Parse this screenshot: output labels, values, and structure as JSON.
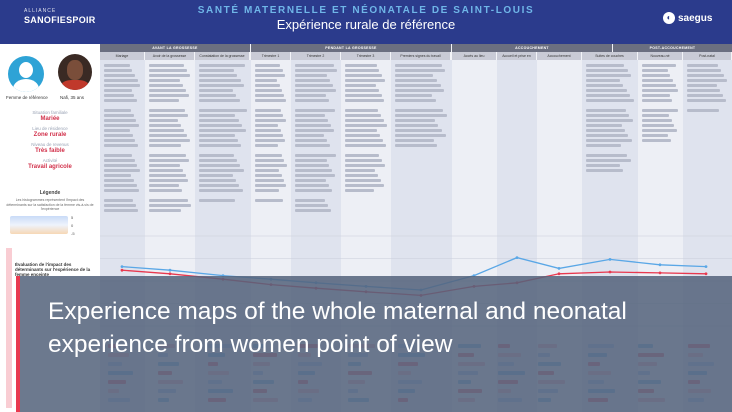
{
  "header": {
    "brand_left_small": "ALLIANCE",
    "brand_left": "SANOFIESPOIR",
    "title": "SANTÉ MATERNELLE ET NÉONATALE DE SAINT-LOUIS",
    "subtitle": "Expérience rurale de référence",
    "brand_right": "saegus"
  },
  "persona": {
    "avatar_caption": "Femme de référence",
    "person_caption": "Nafi, 35 ans",
    "fields": [
      {
        "label": "Situation familiale",
        "value": "Mariée"
      },
      {
        "label": "Lieu de résidence",
        "value": "Zone rurale"
      },
      {
        "label": "Niveau de revenus",
        "value": "Très faible"
      },
      {
        "label": "Activité",
        "value": "Travail agricole"
      }
    ],
    "legend_title": "Légende",
    "legend_text": "Les histogrammes représentent l'impact des déterminants sur la satisfaction de la femme vis-à-vis de l'expérience",
    "legend_top": "5",
    "legend_mid": "0",
    "legend_bot": "-5",
    "eval_title": "Évaluation de l'impact des déterminants sur l'expérience de la femme enceinte"
  },
  "stages": [
    {
      "label": "AVANT LA GROSSESSE"
    },
    {
      "label": "PENDANT LA GROSSESSE"
    },
    {
      "label": "ACCOUCHEMENT"
    },
    {
      "label": "POST-ACCOUCHEMENT"
    }
  ],
  "steps": [
    {
      "label": "Mariage"
    },
    {
      "label": "Avoir de la grossesse"
    },
    {
      "label": "Constatation de la grossesse"
    },
    {
      "label": "Trimestre 1"
    },
    {
      "label": "Trimestre 2"
    },
    {
      "label": "Trimestre 3"
    },
    {
      "label": "Premiers signes du travail"
    },
    {
      "label": "Accès au lieu d'accouchement"
    },
    {
      "label": "Accueil et prise en charge"
    },
    {
      "label": "Accouchement"
    },
    {
      "label": "Suites de couches"
    },
    {
      "label": "Nouveau-né"
    },
    {
      "label": "Post-natal"
    }
  ],
  "chart_data": {
    "type": "line",
    "categories": [
      "Mariage",
      "Avoir de la grossesse",
      "Constatation de la grossesse",
      "Trimestre 1",
      "Trimestre 2",
      "Trimestre 3",
      "Premiers signes du travail",
      "Accès au lieu d'accouchement",
      "Accueil et prise en charge",
      "Accouchement",
      "Suites de couches",
      "Nouveau-né",
      "Post-natal"
    ],
    "series": [
      {
        "values": [
          1.2,
          0.8,
          0.2,
          -0.4,
          -0.8,
          -1.2,
          -1.6,
          -0.6,
          -0.2,
          0.8,
          1.0,
          0.9,
          0.8
        ],
        "color": "#e8394f"
      },
      {
        "values": [
          1.6,
          1.2,
          0.6,
          0.2,
          -0.2,
          -0.6,
          -1.0,
          0.6,
          2.6,
          1.4,
          2.4,
          1.8,
          1.6
        ],
        "color": "#5aa7e6"
      }
    ],
    "ylim": [
      -5,
      5
    ],
    "grid": true
  },
  "overlay": {
    "text": "Experience maps of the whole maternal and neonatal experience from women point of view"
  },
  "colors": {
    "header": "#2b3b8c",
    "accent_red": "#e8394f",
    "accent_blue": "#5aa7e6"
  }
}
